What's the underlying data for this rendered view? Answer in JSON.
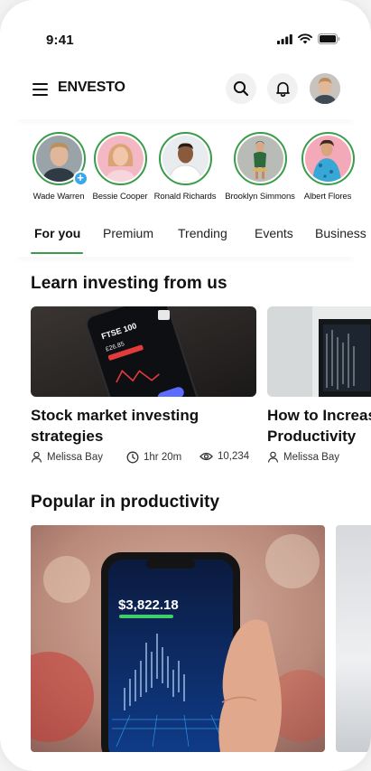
{
  "status_bar": {
    "time": "9:41"
  },
  "header": {
    "brand": "ENVESTO"
  },
  "stories": [
    {
      "name": "Wade Warren",
      "own": true
    },
    {
      "name": "Bessie Cooper"
    },
    {
      "name": "Ronald Richards"
    },
    {
      "name": "Brooklyn Simmons"
    },
    {
      "name": "Albert Flores"
    }
  ],
  "tabs": [
    "For you",
    "Premium",
    "Trending",
    "Events",
    "Business"
  ],
  "learn": {
    "title": "Learn investing from us",
    "cards": [
      {
        "title_line1": "Stock market investing",
        "title_line2": "strategies",
        "author": "Melissa Bay",
        "duration": "1hr 20m",
        "views": "10,234"
      },
      {
        "title_line1": "How to Increase",
        "title_line2": "Productivity",
        "author": "Melissa Bay"
      }
    ]
  },
  "popular": {
    "title": "Popular in productivity",
    "price": "$3,822.18"
  },
  "colors": {
    "accent": "#3a9c4b",
    "badge": "#3ba6e8"
  },
  "icons": [
    "signal-icon",
    "wifi-icon",
    "battery-icon",
    "menu-icon",
    "search-icon",
    "bell-icon",
    "person-icon",
    "clock-icon",
    "eye-icon"
  ]
}
